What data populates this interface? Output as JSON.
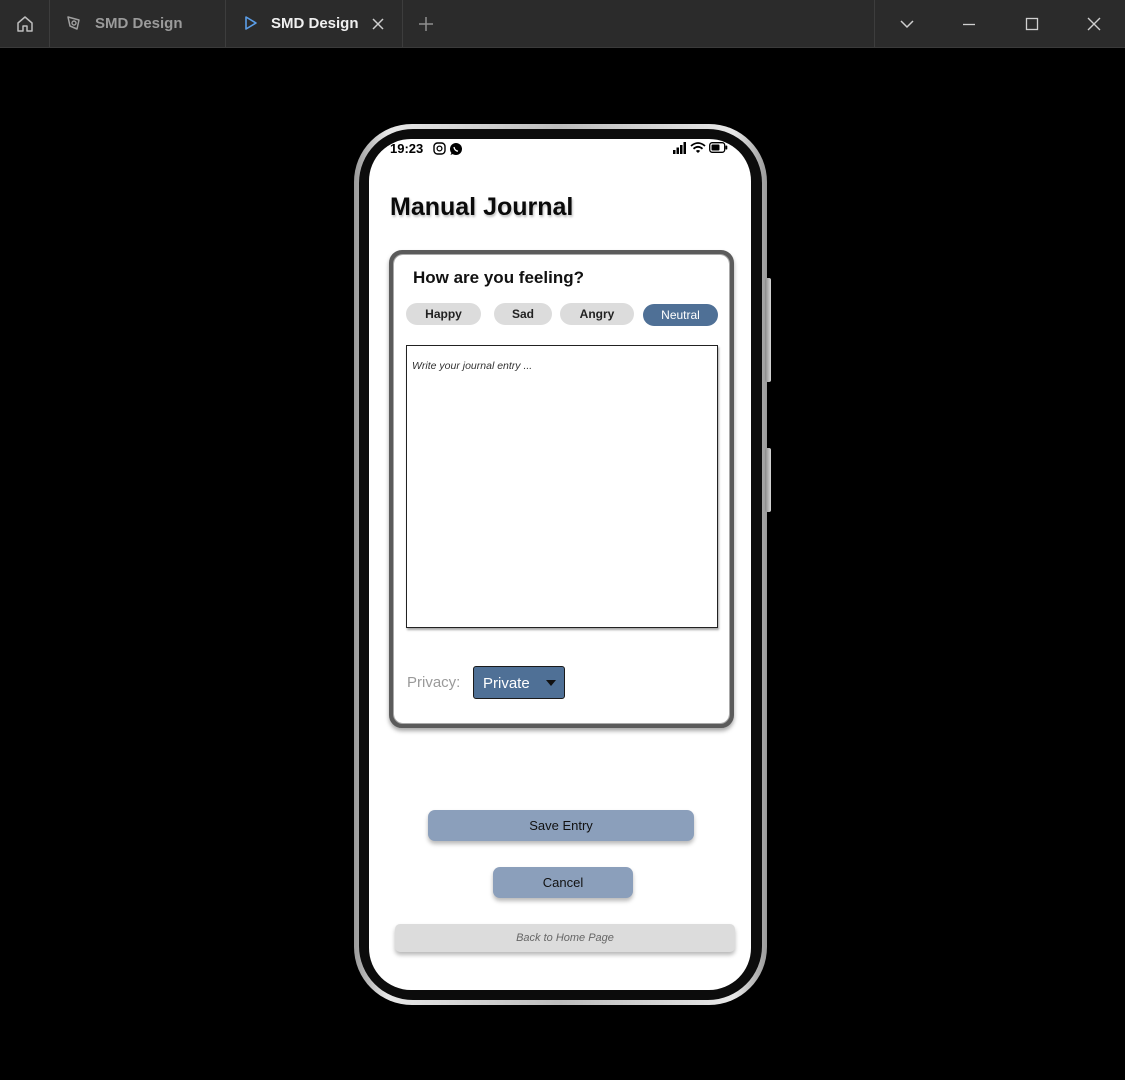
{
  "titlebar": {
    "tabs": [
      {
        "label": "SMD Design",
        "icon": "design-file-icon",
        "active": false
      },
      {
        "label": "SMD Design",
        "icon": "play-icon",
        "active": true
      }
    ],
    "icons": {
      "home": "home-icon",
      "close_tab": "close-icon",
      "new_tab": "plus-icon",
      "tab_list": "chevron-down-icon",
      "minimize": "minimize-icon",
      "maximize": "maximize-icon",
      "close_window": "close-icon"
    }
  },
  "status_bar": {
    "time": "19:23",
    "icons": [
      "instagram-icon",
      "whatsapp-icon",
      "signal-icon",
      "wifi-icon",
      "battery-icon"
    ]
  },
  "page": {
    "title": "Manual Journal"
  },
  "mood_card": {
    "heading": "How are you feeling?",
    "moods": [
      {
        "label": "Happy",
        "selected": false
      },
      {
        "label": "Sad",
        "selected": false
      },
      {
        "label": "Angry",
        "selected": false
      },
      {
        "label": "Neutral",
        "selected": true
      }
    ],
    "entry_placeholder": "Write your journal entry ...",
    "entry_value": "",
    "privacy_label": "Privacy:",
    "privacy_value": "Private"
  },
  "actions": {
    "save_label": "Save Entry",
    "cancel_label": "Cancel",
    "back_label": "Back to Home Page"
  },
  "colors": {
    "selected_mood": "#4f7096",
    "privacy_select": "#4f7096",
    "primary_button": "#8b9fbb",
    "secondary_button": "#dcdcdc",
    "chip": "#dcdcdc"
  }
}
